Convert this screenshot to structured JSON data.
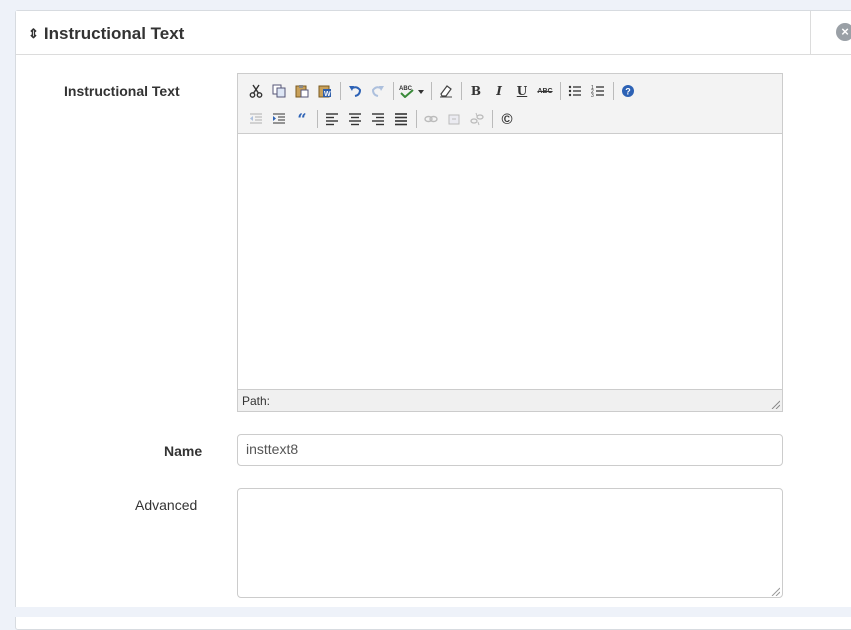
{
  "panel": {
    "title": "Instructional Text",
    "sort_glyph": "⇕",
    "close_glyph": "×"
  },
  "form": {
    "instructional_label": "Instructional Text",
    "name_label": "Name",
    "name_value": "insttext8",
    "advanced_label": "Advanced",
    "advanced_value": ""
  },
  "editor": {
    "path_label": "Path:",
    "toolbar_row1": [
      {
        "name": "cut-icon",
        "glyph": "✂"
      },
      {
        "name": "copy-icon",
        "glyph": "⎘"
      },
      {
        "name": "paste-icon",
        "glyph": "📋"
      },
      {
        "name": "paste-word-icon",
        "glyph": "▤"
      },
      {
        "name": "undo-icon",
        "glyph": "↶"
      },
      {
        "name": "redo-icon",
        "glyph": "↷",
        "disabled": true
      },
      {
        "name": "spellcheck-icon",
        "glyph": "ABC▾"
      },
      {
        "name": "eraser-icon",
        "glyph": "⌫"
      },
      {
        "name": "bold-icon",
        "glyph": "B"
      },
      {
        "name": "italic-icon",
        "glyph": "I"
      },
      {
        "name": "underline-icon",
        "glyph": "U"
      },
      {
        "name": "strikethrough-icon",
        "glyph": "ABC"
      },
      {
        "name": "bullet-list-icon",
        "glyph": "☰"
      },
      {
        "name": "numbered-list-icon",
        "glyph": "☷"
      },
      {
        "name": "help-icon",
        "glyph": "?"
      }
    ],
    "toolbar_row2": [
      {
        "name": "outdent-icon",
        "glyph": "⇤",
        "disabled": true
      },
      {
        "name": "indent-icon",
        "glyph": "⇥"
      },
      {
        "name": "blockquote-icon",
        "glyph": "“"
      },
      {
        "name": "align-left-icon",
        "glyph": "≡"
      },
      {
        "name": "align-center-icon",
        "glyph": "≡"
      },
      {
        "name": "align-right-icon",
        "glyph": "≡"
      },
      {
        "name": "align-justify-icon",
        "glyph": "≣"
      },
      {
        "name": "link-icon",
        "glyph": "∞",
        "disabled": true
      },
      {
        "name": "anchor-icon",
        "glyph": "⚓",
        "disabled": true
      },
      {
        "name": "unlink-icon",
        "glyph": "✄",
        "disabled": true
      },
      {
        "name": "copyright-icon",
        "glyph": "©"
      }
    ]
  }
}
